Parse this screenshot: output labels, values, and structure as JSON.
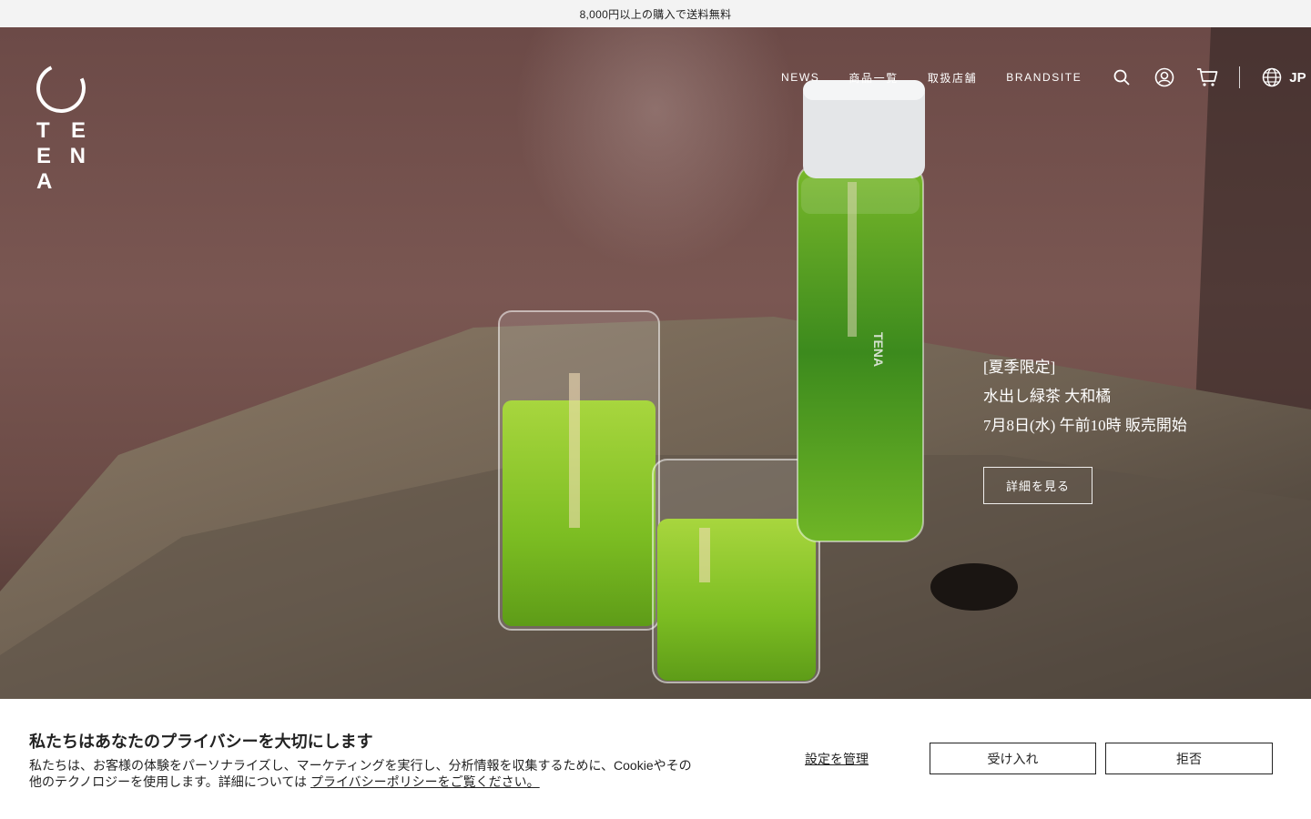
{
  "announcement": {
    "text": "8,000円以上の購入で送料無料"
  },
  "logo": {
    "letters": [
      "T",
      "E",
      "E",
      "N",
      "A"
    ],
    "row1": "T E",
    "row2": "E N",
    "row3": "A"
  },
  "nav": {
    "links": [
      "NEWS",
      "商品一覧",
      "取扱店舗",
      "BRANDSITE"
    ],
    "icons": [
      "search-icon",
      "account-icon",
      "cart-icon"
    ],
    "language": "JP"
  },
  "hero": {
    "promo_line1": "[夏季限定]",
    "promo_line2": "水出し緑茶 大和橘",
    "promo_line3": "7月8日(水) 午前10時 販売開始",
    "button_label": "詳細を見る",
    "bottle_logo": "TENA"
  },
  "cookie": {
    "title": "私たちはあなたのプライバシーを大切にします",
    "body": "私たちは、お客様の体験をパーソナライズし、マーケティングを実行し、分析情報を収集するために、Cookieやその他のテクノロジーを使用します。詳細については",
    "link": "プライバシーポリシーをご覧ください。",
    "manage_label": "設定を管理",
    "accept_label": "受け入れ",
    "reject_label": "拒否"
  },
  "colors": {
    "announcement_bg": "#f3f3f3",
    "tea_green": "#7fc12b",
    "wall": "#7a5752"
  }
}
